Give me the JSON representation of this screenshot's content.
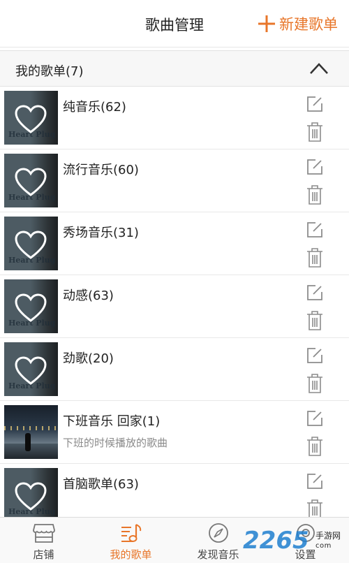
{
  "header": {
    "title": "歌曲管理",
    "new_button_label": "新建歌单"
  },
  "section": {
    "label": "我的歌单(7)"
  },
  "playlists": [
    {
      "name": "纯音乐(62)",
      "desc": "",
      "thumb": "heart-plug"
    },
    {
      "name": "流行音乐(60)",
      "desc": "",
      "thumb": "heart-plug"
    },
    {
      "name": "秀场音乐(31)",
      "desc": "",
      "thumb": "heart-plug"
    },
    {
      "name": "动感(63)",
      "desc": "",
      "thumb": "heart-plug"
    },
    {
      "name": "劲歌(20)",
      "desc": "",
      "thumb": "heart-plug"
    },
    {
      "name": "下班音乐 回家(1)",
      "desc": "下班的时候播放的歌曲",
      "thumb": "city-night"
    },
    {
      "name": "首脑歌单(63)",
      "desc": "",
      "thumb": "heart-plug"
    }
  ],
  "thumb_brand": "Heart Plug",
  "tabbar": {
    "tabs": [
      {
        "label": "店铺",
        "icon": "shop-icon",
        "active": false
      },
      {
        "label": "我的歌单",
        "icon": "music-note-icon",
        "active": true
      },
      {
        "label": "发现音乐",
        "icon": "compass-icon",
        "active": false
      },
      {
        "label": "设置",
        "icon": "settings-icon",
        "active": false
      }
    ]
  },
  "watermark": {
    "number": "2265",
    "text": "手游网",
    "sub": "com"
  },
  "colors": {
    "accent": "#e8762a",
    "watermark_blue": "#1f7fcf"
  }
}
